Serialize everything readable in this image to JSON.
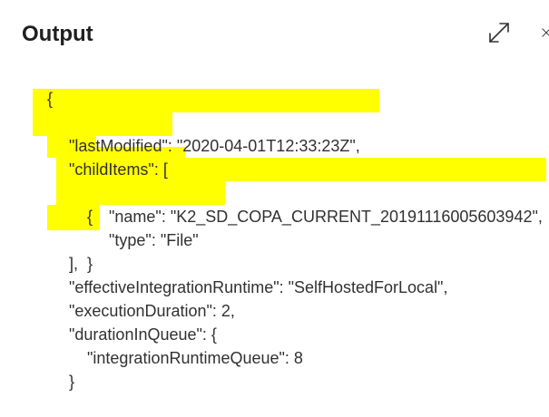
{
  "panel": {
    "title": "Output"
  },
  "icons": {
    "expand": "expand-diagonal-icon",
    "close": "close-icon"
  },
  "colors": {
    "highlight": "#ffff00",
    "text": "#323130"
  },
  "output_lines": [
    "{",
    "\"lastModified\": \"2020-04-01T12:33:23Z\",",
    "\"childItems\": [",
    "{",
    "\"name\": \"K2_SD_COPA_CURRENT_20191116005603942\",",
    "\"type\": \"File\"",
    "}",
    "],",
    "\"effectiveIntegrationRuntime\": \"SelfHostedForLocal\",",
    "\"executionDuration\": 2,",
    "\"durationInQueue\": {",
    "\"integrationRuntimeQueue\": 8",
    "}"
  ]
}
